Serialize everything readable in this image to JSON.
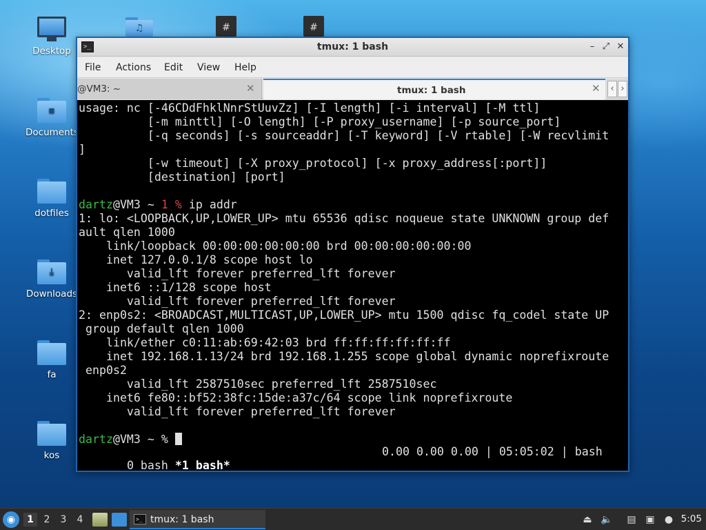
{
  "desktop": {
    "icons": [
      {
        "label": "Desktop",
        "icon": "monitor-icon"
      },
      {
        "label": "Documents",
        "icon": "folder-documents-icon"
      },
      {
        "label": "dotfiles",
        "icon": "folder-icon"
      },
      {
        "label": "Downloads",
        "icon": "folder-downloads-icon"
      },
      {
        "label": "fa",
        "icon": "folder-icon"
      },
      {
        "label": "kos",
        "icon": "folder-icon"
      }
    ]
  },
  "window": {
    "title": "tmux: 1 bash",
    "menu": [
      "File",
      "Actions",
      "Edit",
      "View",
      "Help"
    ],
    "tabs": [
      {
        "label": "@VM3: ~",
        "active": false
      },
      {
        "label": "tmux: 1 bash",
        "active": true
      }
    ]
  },
  "terminal": {
    "lines": [
      "usage: nc [-46CDdFhklNnrStUuvZz] [-I length] [-i interval] [-M ttl]",
      "          [-m minttl] [-O length] [-P proxy_username] [-p source_port]",
      "          [-q seconds] [-s sourceaddr] [-T keyword] [-V rtable] [-W recvlimit",
      "]",
      "          [-w timeout] [-X proxy_protocol] [-x proxy_address[:port]]",
      "          [destination] [port]",
      "",
      "PROMPT1",
      "1: lo: <LOOPBACK,UP,LOWER_UP> mtu 65536 qdisc noqueue state UNKNOWN group def",
      "ault qlen 1000",
      "    link/loopback 00:00:00:00:00:00 brd 00:00:00:00:00:00",
      "    inet 127.0.0.1/8 scope host lo",
      "       valid_lft forever preferred_lft forever",
      "    inet6 ::1/128 scope host",
      "       valid_lft forever preferred_lft forever",
      "2: enp0s2: <BROADCAST,MULTICAST,UP,LOWER_UP> mtu 1500 qdisc fq_codel state UP",
      " group default qlen 1000",
      "    link/ether c0:11:ab:69:42:03 brd ff:ff:ff:ff:ff:ff",
      "    inet 192.168.1.13/24 brd 192.168.1.255 scope global dynamic noprefixroute",
      " enp0s2",
      "       valid_lft 2587510sec preferred_lft 2587510sec",
      "    inet6 fe80::bf52:38fc:15de:a37c/64 scope link noprefixroute",
      "       valid_lft forever preferred_lft forever",
      "",
      "PROMPT2"
    ],
    "prompt1": {
      "user": "dartz",
      "host": "@VM3 ~ ",
      "code": "1 %",
      "command": " ip addr"
    },
    "prompt2": {
      "user": "dartz",
      "host": "@VM3 ~ %",
      "command": " "
    },
    "status": {
      "windows_left": " 0 bash ",
      "active_window": "*1 bash*",
      "right": "0.00 0.00 0.00 | 05:05:02 | bash"
    }
  },
  "taskbar": {
    "workspaces": [
      "1",
      "2",
      "3",
      "4"
    ],
    "active_workspace": "1",
    "task_label": "tmux: 1 bash",
    "clock": "5:05"
  }
}
